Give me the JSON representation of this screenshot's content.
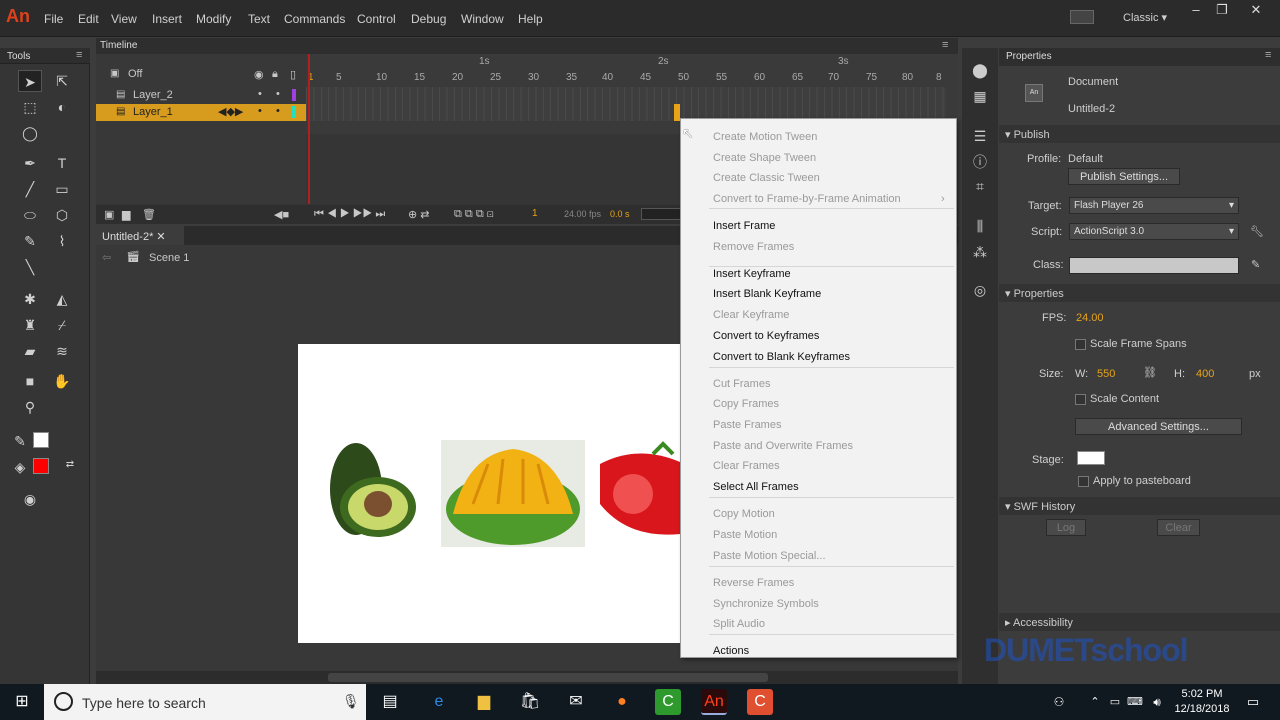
{
  "app": {
    "logo": "An",
    "workspace": "Classic"
  },
  "menu": [
    "File",
    "Edit",
    "View",
    "Insert",
    "Modify",
    "Text",
    "Commands",
    "Control",
    "Debug",
    "Window",
    "Help"
  ],
  "tools": {
    "title": "Tools"
  },
  "timeline": {
    "title": "Timeline",
    "layers": [
      {
        "name": "Off"
      },
      {
        "name": "Layer_2"
      },
      {
        "name": "Layer_1"
      }
    ],
    "ruler": [
      "1",
      "5",
      "10",
      "15",
      "20",
      "25",
      "30",
      "35",
      "40",
      "45",
      "50",
      "55",
      "60",
      "65",
      "70",
      "75",
      "80",
      "8"
    ],
    "seconds": [
      "1s",
      "2s",
      "3s"
    ],
    "current_frame": "1",
    "fps": "24.00 fps",
    "time": "0.0 s"
  },
  "document": {
    "tab": "Untitled-2*",
    "scene": "Scene 1"
  },
  "context_menu": [
    {
      "label": "Create Motion Tween",
      "enabled": false
    },
    {
      "label": "Create Shape Tween",
      "enabled": false
    },
    {
      "label": "Create Classic Tween",
      "enabled": false
    },
    {
      "label": "Convert to Frame-by-Frame Animation",
      "enabled": false,
      "submenu": true
    },
    {
      "label": "Insert Frame",
      "enabled": true
    },
    {
      "label": "Remove Frames",
      "enabled": false
    },
    {
      "label": "Insert Keyframe",
      "enabled": true
    },
    {
      "label": "Insert Blank Keyframe",
      "enabled": true
    },
    {
      "label": "Clear Keyframe",
      "enabled": false
    },
    {
      "label": "Convert to Keyframes",
      "enabled": true
    },
    {
      "label": "Convert to Blank Keyframes",
      "enabled": true
    },
    {
      "label": "Cut Frames",
      "enabled": false
    },
    {
      "label": "Copy Frames",
      "enabled": false
    },
    {
      "label": "Paste Frames",
      "enabled": false
    },
    {
      "label": "Paste and Overwrite Frames",
      "enabled": false
    },
    {
      "label": "Clear Frames",
      "enabled": false
    },
    {
      "label": "Select All Frames",
      "enabled": true
    },
    {
      "label": "Copy Motion",
      "enabled": false
    },
    {
      "label": "Paste Motion",
      "enabled": false
    },
    {
      "label": "Paste Motion Special...",
      "enabled": false
    },
    {
      "label": "Reverse Frames",
      "enabled": false
    },
    {
      "label": "Synchronize Symbols",
      "enabled": false
    },
    {
      "label": "Split Audio",
      "enabled": false
    },
    {
      "label": "Actions",
      "enabled": true
    }
  ],
  "properties": {
    "title": "Properties",
    "doc_type": "Document",
    "doc_name": "Untitled-2",
    "publish": {
      "section": "Publish",
      "profile_label": "Profile:",
      "profile": "Default",
      "settings_btn": "Publish Settings...",
      "target_label": "Target:",
      "target": "Flash Player 26",
      "script_label": "Script:",
      "script": "ActionScript 3.0",
      "class_label": "Class:"
    },
    "props": {
      "section": "Properties",
      "fps_label": "FPS:",
      "fps": "24.00",
      "scale_spans": "Scale Frame Spans",
      "size_label": "Size:",
      "w_label": "W:",
      "w": "550",
      "h_label": "H:",
      "h": "400",
      "unit": "px",
      "scale_content": "Scale Content",
      "advanced_btn": "Advanced Settings...",
      "stage_label": "Stage:",
      "pasteboard": "Apply to pasteboard"
    },
    "swf": {
      "section": "SWF History",
      "log": "Log",
      "clear": "Clear"
    },
    "accessibility": "Accessibility"
  },
  "taskbar": {
    "search_placeholder": "Type here to search",
    "time": "5:02 PM",
    "date": "12/18/2018"
  },
  "watermark": "DUMETschool"
}
